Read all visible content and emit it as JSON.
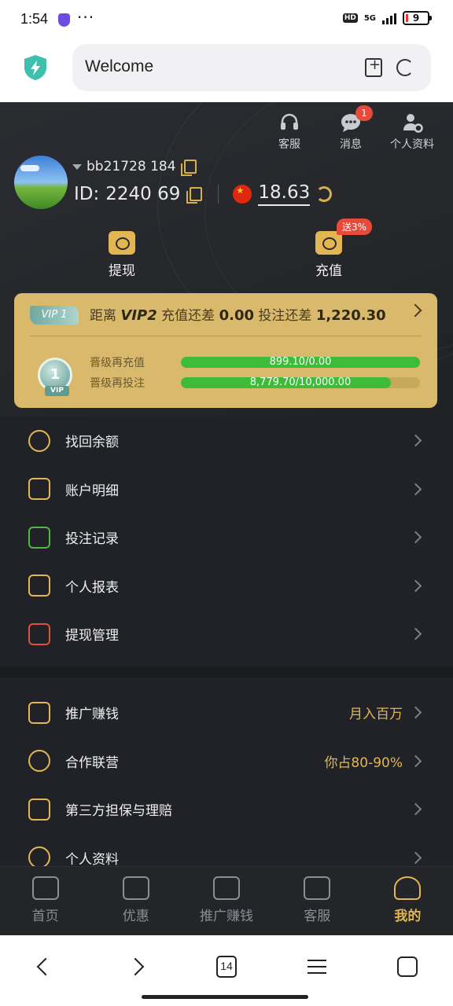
{
  "statusbar": {
    "time": "1:54",
    "dots": "···",
    "hd": "HD",
    "net": "5G",
    "battery": "9"
  },
  "browser": {
    "address_text": "Welcome",
    "tab_count": "14"
  },
  "header": {
    "icons": [
      {
        "label": "客服"
      },
      {
        "label": "消息",
        "badge": "1"
      },
      {
        "label": "个人资料"
      }
    ]
  },
  "user": {
    "username": "bb21728  184",
    "id_label": "ID:",
    "id_value": "2240   69",
    "balance": "18.63"
  },
  "actions": {
    "withdraw": "提现",
    "deposit": "充值",
    "deposit_badge": "送3%"
  },
  "vip": {
    "tag": "VIP 1",
    "text_prefix": "距离",
    "next_level": "VIP2",
    "deposit_text": "充值还差",
    "deposit_gap": "0.00",
    "bet_text": "投注还差",
    "bet_gap": "1,220.30",
    "medal": "1",
    "deposit_row_label": "晋级再充值",
    "deposit_progress_text": "899.10/0.00",
    "deposit_progress": 1.0,
    "bet_row_label": "晋级再投注",
    "bet_progress_text": "8,779.70/10,000.00",
    "bet_progress": 0.878
  },
  "menu1": [
    {
      "label": "找回余额",
      "icon": "search-coin-icon"
    },
    {
      "label": "账户明细",
      "icon": "document-icon"
    },
    {
      "label": "投注记录",
      "icon": "list-icon"
    },
    {
      "label": "个人报表",
      "icon": "report-icon"
    },
    {
      "label": "提现管理",
      "icon": "card-settings-icon"
    }
  ],
  "menu2": [
    {
      "label": "推广赚钱",
      "extra": "月入百万",
      "icon": "share-icon"
    },
    {
      "label": "合作联营",
      "extra": "你占80-90%",
      "icon": "club-icon"
    },
    {
      "label": "第三方担保与理赔",
      "extra": "",
      "icon": "shield-dollar-icon"
    },
    {
      "label": "个人资料",
      "extra": "",
      "icon": "user-icon"
    }
  ],
  "tabs": [
    {
      "label": "首页",
      "icon": "home-icon"
    },
    {
      "label": "优惠",
      "icon": "gift-icon"
    },
    {
      "label": "推广赚钱",
      "icon": "promote-icon"
    },
    {
      "label": "客服",
      "icon": "headset-icon"
    },
    {
      "label": "我的",
      "icon": "profile-icon",
      "active": true
    }
  ],
  "colors": {
    "accent": "#e2b652",
    "vip_card": "#d9b96c",
    "progress": "#3fbb3a",
    "badge": "#e64a3b"
  }
}
